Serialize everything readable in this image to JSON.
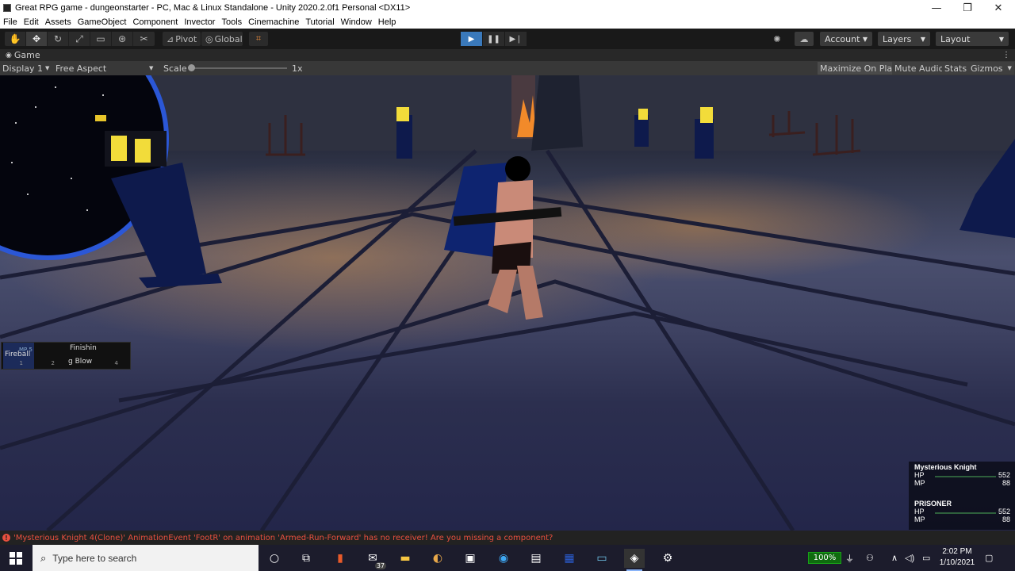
{
  "window": {
    "title": "Great RPG game - dungeonstarter - PC, Mac & Linux Standalone - Unity 2020.2.0f1 Personal <DX11>",
    "minimize": "—",
    "maximize": "❐",
    "close": "✕"
  },
  "menu": [
    "File",
    "Edit",
    "Assets",
    "GameObject",
    "Component",
    "Invector",
    "Tools",
    "Cinemachine",
    "Tutorial",
    "Window",
    "Help"
  ],
  "toolbar": {
    "pivot_label": "Pivot",
    "global_label": "Global",
    "account_label": "Account",
    "layers_label": "Layers",
    "layout_label": "Layout"
  },
  "game_tab": {
    "tab_label": "Game",
    "display": "Display 1",
    "aspect": "Free Aspect",
    "scale_label": "Scale",
    "scale_value": "1x",
    "scale_fraction": 0.0,
    "maximize_on_play": "Maximize On Play",
    "mute_audio": "Mute Audio",
    "stats": "Stats",
    "gizmos": "Gizmos"
  },
  "skills": [
    {
      "name": "Fireball",
      "cost": "MP 5",
      "key": "1"
    },
    {
      "name": "",
      "cost": "",
      "key": "2"
    },
    {
      "name_line1": "Finishin",
      "name_line2": "g Blow",
      "key": "4"
    }
  ],
  "party": [
    {
      "name": "Mysterious Knight",
      "hp_label": "HP",
      "hp": "552",
      "mp_label": "MP",
      "mp": "88"
    },
    {
      "name": "PRISONER",
      "hp_label": "HP",
      "hp": "552",
      "mp_label": "MP",
      "mp": "88"
    }
  ],
  "console": {
    "message": "'Mysterious Knight 4(Clone)' AnimationEvent 'FootR' on animation 'Armed-Run-Forward' has no receiver! Are you missing a component?"
  },
  "taskbar": {
    "search_placeholder": "Type here to search",
    "mail_badge": "37",
    "battery": "100%",
    "time": "2:02 PM",
    "date": "1/10/2021"
  }
}
